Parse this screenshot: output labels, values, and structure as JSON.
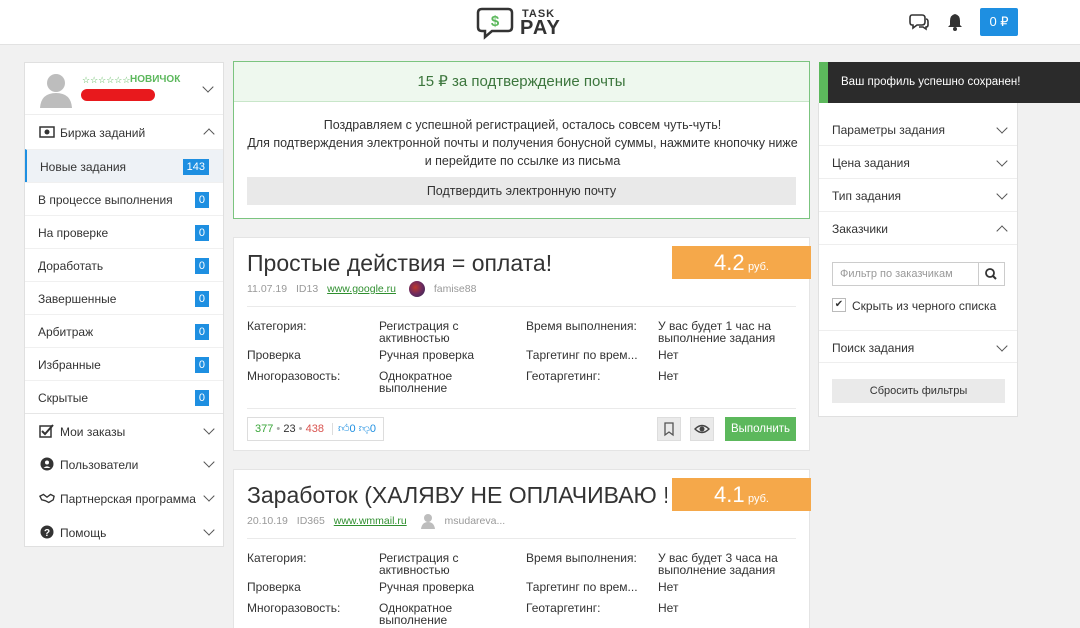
{
  "header": {
    "logo_top": "TASK",
    "logo_bottom": "PAY",
    "balance": "0 ₽"
  },
  "sidebar": {
    "rank": "НОВИЧОК",
    "stars": "☆☆☆☆☆☆",
    "section_main": "Биржа заданий",
    "items": [
      {
        "label": "Новые задания",
        "count": "143"
      },
      {
        "label": "В процессе выполнения",
        "count": "0"
      },
      {
        "label": "На проверке",
        "count": "0"
      },
      {
        "label": "Доработать",
        "count": "0"
      },
      {
        "label": "Завершенные",
        "count": "0"
      },
      {
        "label": "Арбитраж",
        "count": "0"
      },
      {
        "label": "Избранные",
        "count": "0"
      },
      {
        "label": "Скрытые",
        "count": "0"
      }
    ],
    "sections": [
      {
        "label": "Мои заказы"
      },
      {
        "label": "Пользователи"
      },
      {
        "label": "Партнерская программа"
      },
      {
        "label": "Помощь"
      }
    ]
  },
  "confirm": {
    "title": "15 ₽ за подтверждение почты",
    "line1": "Поздравляем с успешной регистрацией, осталось совсем чуть-чуть!",
    "line2": "Для подтверждения электронной почты и получения бонусной суммы, нажмите кнопочку ниже",
    "line3": "и перейдите по ссылке из письма",
    "button": "Подтвердить электронную почту"
  },
  "tasks": [
    {
      "title": "Простые действия = оплата!",
      "price": "4.2",
      "currency": "руб.",
      "date": "11.07.19",
      "id": "ID13",
      "site": "www.google.ru",
      "user": "famise88",
      "category_label": "Категория:",
      "category_value_1": "Регистрация с",
      "category_value_2": "активностью",
      "check_label": "Проверка",
      "check_value": "Ручная проверка",
      "multi_label": "Многоразовость:",
      "multi_value_1": "Однократное",
      "multi_value_2": "выполнение",
      "time_label": "Время выполнения:",
      "time_value_1": "У вас будет 1 час на",
      "time_value_2": "выполнение задания",
      "target_label": "Таргетинг по врем...",
      "target_value": "Нет",
      "geo_label": "Геотаргетинг:",
      "geo_value": "Нет",
      "stat_done": "377",
      "stat_mid": "23",
      "stat_fail": "438",
      "likes": "0",
      "dislikes": "0",
      "do_label": "Выполнить"
    },
    {
      "title": "Заработок (ХАЛЯВУ НЕ ОПЛАЧИВАЮ !!!...",
      "price": "4.1",
      "currency": "руб.",
      "date": "20.10.19",
      "id": "ID365",
      "site": "www.wmmail.ru",
      "user": "msudareva...",
      "category_label": "Категория:",
      "category_value_1": "Регистрация с",
      "category_value_2": "активностью",
      "check_label": "Проверка",
      "check_value": "Ручная проверка",
      "multi_label": "Многоразовость:",
      "multi_value_1": "Однократное",
      "multi_value_2": "выполнение",
      "time_label": "Время выполнения:",
      "time_value_1": "У вас будет 3 часа на",
      "time_value_2": "выполнение задания",
      "target_label": "Таргетинг по врем...",
      "target_value": "Нет",
      "geo_label": "Геотаргетинг:",
      "geo_value": "Нет"
    }
  ],
  "filters": {
    "items": [
      {
        "label": "Параметры задания"
      },
      {
        "label": "Цена задания"
      },
      {
        "label": "Тип задания"
      },
      {
        "label": "Заказчики"
      }
    ],
    "customer_placeholder": "Фильтр по заказчикам",
    "blacklist_label": "Скрыть из черного списка",
    "blacklist_checked": "✔",
    "search_label": "Поиск задания",
    "reset": "Сбросить фильтры"
  },
  "toast": {
    "message": "Ваш профиль успешно сохранен!",
    "accent": "#5cb85c"
  }
}
